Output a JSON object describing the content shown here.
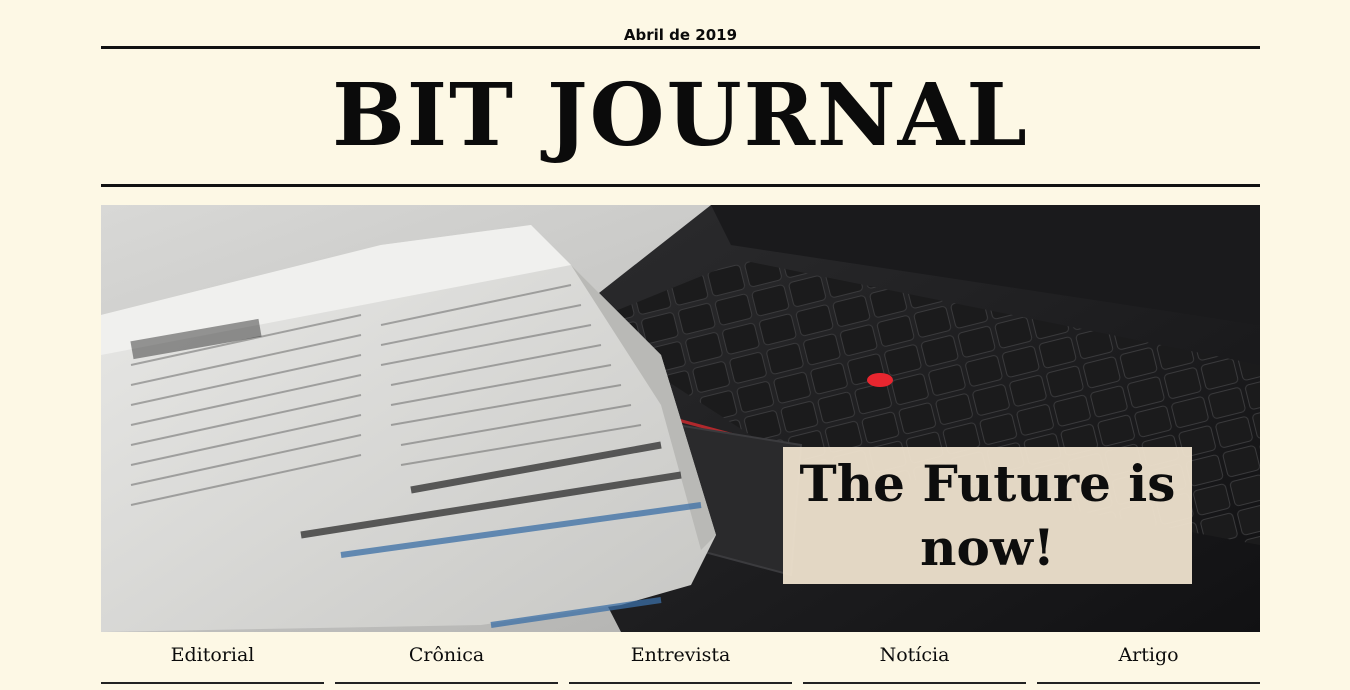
{
  "header": {
    "date": "Abril de 2019",
    "title": "BIT JOURNAL"
  },
  "hero": {
    "headline": "The Future is now!",
    "image_subject": "folded newspaper on laptop keyboard"
  },
  "nav": {
    "items": [
      {
        "label": "Editorial"
      },
      {
        "label": "Crônica"
      },
      {
        "label": "Entrevista"
      },
      {
        "label": "Notícia"
      },
      {
        "label": "Artigo"
      }
    ]
  },
  "colors": {
    "background": "#fdf8e5",
    "text": "#0b0b0b",
    "headline_box": "#eee2cd",
    "trackpoint": "#e8262f"
  }
}
